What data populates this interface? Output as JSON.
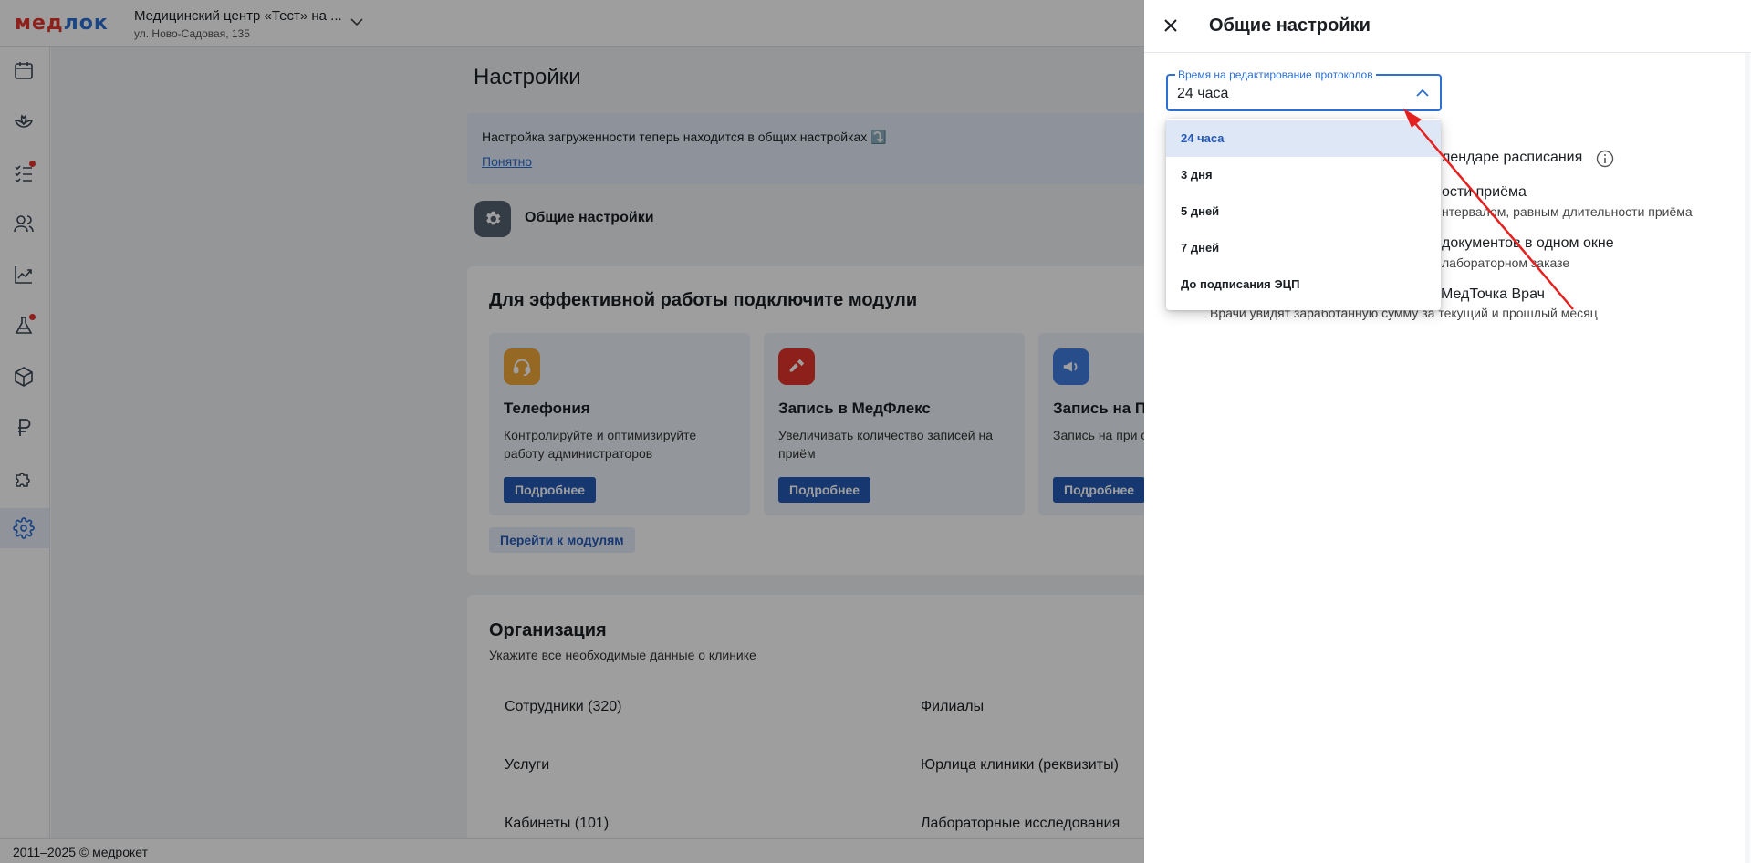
{
  "header": {
    "logo_part1": "мед",
    "logo_part2": "лок",
    "clinic_name": "Медицинский центр «Тест» на ...",
    "clinic_address": "ул. Ново-Садовая, 135"
  },
  "sidebar": {
    "items": [
      {
        "icon": "calendar-icon"
      },
      {
        "icon": "lotus-icon"
      },
      {
        "icon": "checklist-icon",
        "badge": true
      },
      {
        "icon": "users-icon"
      },
      {
        "icon": "chart-icon"
      },
      {
        "icon": "flask-icon",
        "badge": true
      },
      {
        "icon": "box-icon"
      },
      {
        "icon": "ruble-icon"
      },
      {
        "icon": "puzzle-icon"
      },
      {
        "icon": "gear-icon",
        "active": true
      }
    ]
  },
  "page": {
    "title": "Настройки",
    "notice_text": "Настройка загруженности теперь находится в общих настройках ⤵️",
    "notice_link": "Понятно",
    "general_settings_label": "Общие настройки"
  },
  "modules": {
    "title": "Для эффективной работы подключите модули",
    "cards": [
      {
        "title": "Телефония",
        "desc": "Контролируйте и оптимизируйте работу администраторов",
        "button": "Подробнее",
        "icon": "headset-icon",
        "color": "#f0a93b"
      },
      {
        "title": "Запись в МедФлекс",
        "desc": "Увеличивать количество записей на приём",
        "button": "Подробнее",
        "icon": "medflex-icon",
        "color": "#e5352d"
      },
      {
        "title": "Запись на Пр",
        "desc": "Запись на при сервиса по пом",
        "button": "Подробнее",
        "icon": "megaphone-icon",
        "color": "#3f7fe0"
      }
    ],
    "goto_button": "Перейти к модулям"
  },
  "organization": {
    "title": "Организация",
    "subtitle": "Укажите все необходимые данные о клинике",
    "left_items": [
      "Сотрудники (320)",
      "Услуги",
      "Кабинеты (101)"
    ],
    "right_items": [
      "Филиалы",
      "Юрлица клиники (реквизиты)",
      "Лабораторные исследования"
    ]
  },
  "footer": {
    "text": "2011–2025 © медрокет"
  },
  "drawer": {
    "title": "Общие настройки",
    "select": {
      "label": "Время на редактирование протоколов",
      "value": "24 часа",
      "options": [
        "24 часа",
        "3 дня",
        "5 дней",
        "7 дней",
        "До подписания ЭЦП"
      ],
      "selected_index": 0
    },
    "settings": [
      {
        "main": "лендаре расписания"
      },
      {
        "main": "ости приёма",
        "sub": "нтервалом, равным длительности приёма"
      },
      {
        "main": "документов в одном окне",
        "sub": "лабораторном заказе"
      },
      {
        "main": "МедТочка Врач",
        "sub": "Врачи увидят заработанную сумму за текущий и прошлый месяц"
      }
    ]
  },
  "colors": {
    "accent": "#2d6fd2",
    "button": "#2459b5",
    "annotation_arrow": "#e5201e"
  }
}
